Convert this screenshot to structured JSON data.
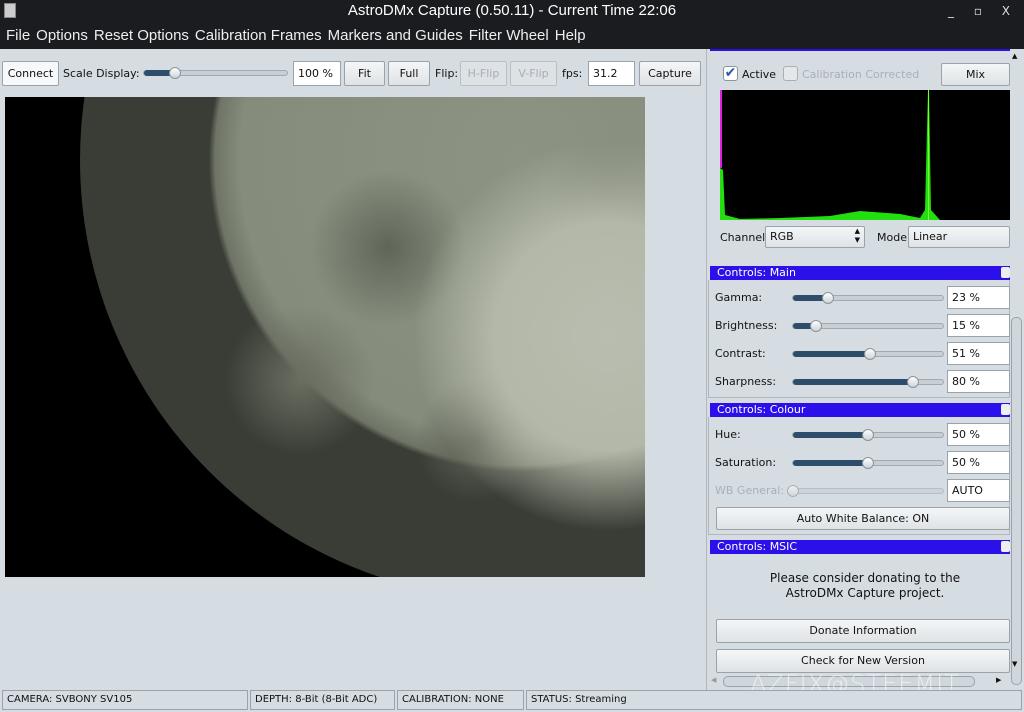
{
  "window": {
    "title": "AstroDMx Capture (0.50.11) - Current Time 22:06",
    "controls": "_ ▫ X"
  },
  "menu": [
    "File",
    "Options",
    "Reset Options",
    "Calibration Frames",
    "Markers and Guides",
    "Filter Wheel",
    "Help"
  ],
  "toolbar": {
    "connect": "Connect",
    "scale_label": "Scale Display:",
    "scale_value": 0.22,
    "zoom": "100 %",
    "fit": "Fit",
    "full": "Full",
    "flip_label": "Flip:",
    "hflip": "H-Flip",
    "vflip": "V-Flip",
    "fps_label": "fps:",
    "fps": "31.2",
    "capture": "Capture"
  },
  "histogram": {
    "active": "Active",
    "active_checked": true,
    "calibration": "Calibration Corrected",
    "calibration_checked": false,
    "mix": "Mix",
    "channel_label": "Channel:",
    "channel": "RGB",
    "mode_label": "Mode:",
    "mode": "Linear",
    "colors": {
      "peak": "#7cff2a",
      "fill": "#22e010",
      "magenta": "#e020e0"
    }
  },
  "main": {
    "title": "Controls: Main",
    "controls": [
      {
        "label": "Gamma:",
        "value": "23 %",
        "level": 23
      },
      {
        "label": "Brightness:",
        "value": "15 %",
        "level": 15
      },
      {
        "label": "Contrast:",
        "value": "51 %",
        "level": 51
      },
      {
        "label": "Sharpness:",
        "value": "80 %",
        "level": 80
      }
    ]
  },
  "colour": {
    "title": "Controls: Colour",
    "controls": [
      {
        "label": "Hue:",
        "value": "50 %",
        "level": 50
      },
      {
        "label": "Saturation:",
        "value": "50 %",
        "level": 50
      },
      {
        "label": "WB General:",
        "value": "AUTO",
        "level": 0
      }
    ],
    "awb": "Auto White Balance: ON"
  },
  "msic": {
    "title": "Controls: MSIC",
    "line1": "Please consider donating to the",
    "line2": "AstroDMx Capture project.",
    "donate": "Donate Information",
    "check": "Check for New Version"
  },
  "watermark": "AZFIX@STEEMIT",
  "status": [
    "CAMERA: SVBONY SV105",
    "DEPTH: 8-Bit (8-Bit ADC)",
    "CALIBRATION: NONE",
    "STATUS: Streaming"
  ],
  "accent": "#2c10ea"
}
